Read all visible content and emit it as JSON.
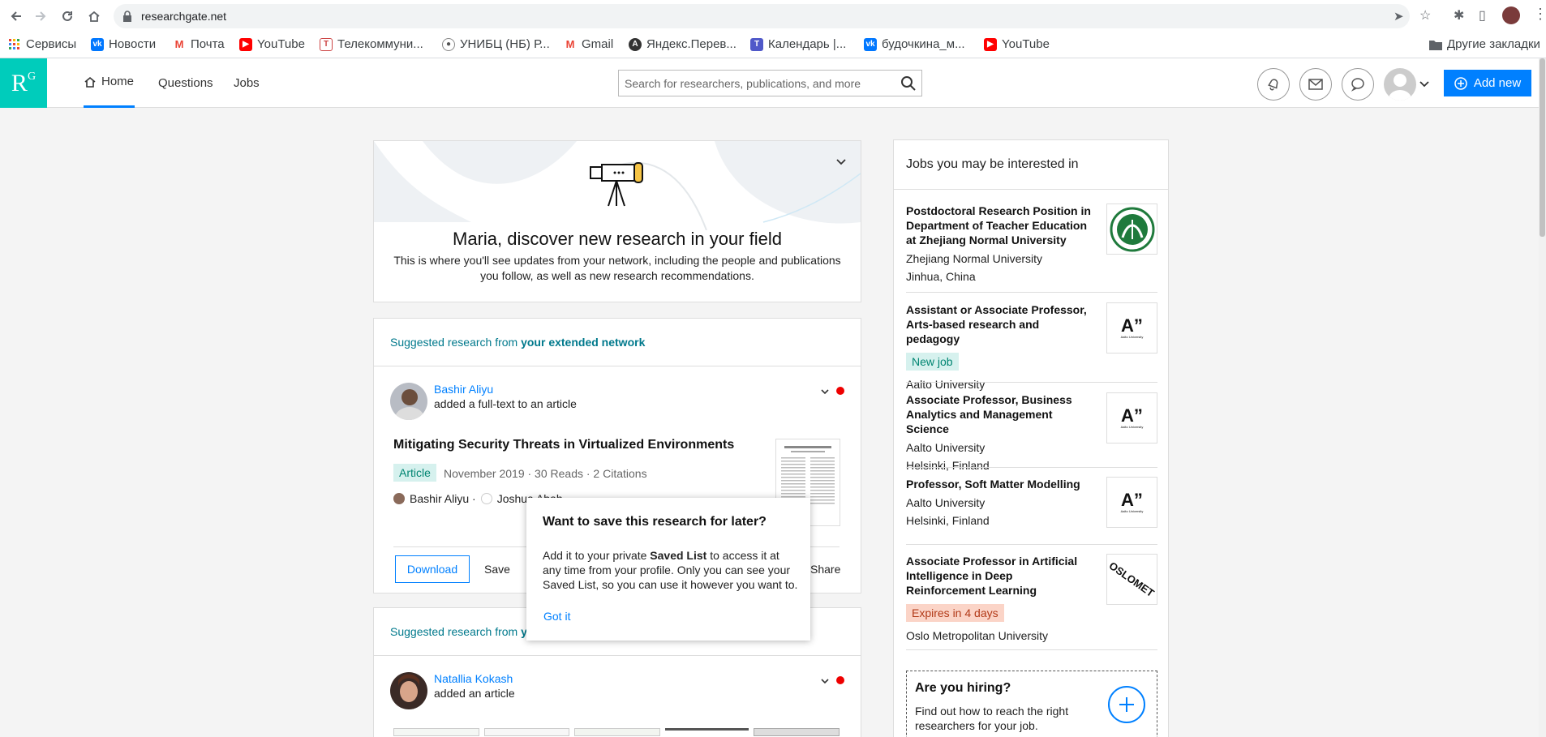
{
  "browser": {
    "url": "researchgate.net",
    "bookmarks": [
      {
        "label": "Сервисы",
        "icon": "apps-grid-icon"
      },
      {
        "label": "Новости",
        "icon": "vk-icon"
      },
      {
        "label": "Почта",
        "icon": "gmail-icon"
      },
      {
        "label": "YouTube",
        "icon": "youtube-icon"
      },
      {
        "label": "Телекоммуни...",
        "icon": "site-icon"
      },
      {
        "label": "УНИБЦ (НБ) Р...",
        "icon": "site-icon"
      },
      {
        "label": "Gmail",
        "icon": "gmail-icon"
      },
      {
        "label": "Яндекс.Перев...",
        "icon": "yandex-translate-icon"
      },
      {
        "label": "Календарь |...",
        "icon": "teams-icon"
      },
      {
        "label": "будочкина_м...",
        "icon": "vk-icon"
      },
      {
        "label": "YouTube",
        "icon": "youtube-icon"
      }
    ],
    "other_bookmarks": "Другие закладки"
  },
  "header": {
    "logo": "R",
    "logo_sup": "G",
    "tabs": [
      {
        "label": "Home"
      },
      {
        "label": "Questions"
      },
      {
        "label": "Jobs"
      }
    ],
    "search_placeholder": "Search for researchers, publications, and more",
    "add_new": "Add new"
  },
  "hero": {
    "title": "Maria, discover new research in your field",
    "text": "This is where you'll see updates from your network, including the people and publications you follow, as well as new research recommendations."
  },
  "feed": [
    {
      "heading_prefix": "Suggested research from ",
      "heading_strong": "your extended network",
      "person": "Bashir Aliyu",
      "action": "added a full-text to an article",
      "pub_title": "Mitigating Security Threats in Virtualized Environments",
      "badge": "Article",
      "meta": "November 2019 · 30 Reads · 2 Citations",
      "author1": "Bashir Aliyu ·",
      "author2": "Joshua Abah",
      "download": "Download",
      "save": "Save",
      "share": "Share"
    },
    {
      "heading_prefix": "Suggested research from ",
      "heading_strong": "yo",
      "person": "Natallia Kokash",
      "action": "added an article"
    }
  ],
  "popup": {
    "title": "Want to save this research for later?",
    "body_1": "Add it to your private ",
    "body_strong": "Saved List",
    "body_2": " to access it at any time from your profile. Only you can see your Saved List, so you can use it however you want to.",
    "got_it": "Got it"
  },
  "jobs": {
    "title": "Jobs you may be interested in",
    "items": [
      {
        "title": "Postdoctoral Research Position in Department of Teacher Education at Zhejiang Normal University",
        "org": "Zhejiang Normal University",
        "location": "Jinhua, China",
        "badge": "",
        "logo": "zjnu-seal"
      },
      {
        "title": "Assistant or Associate Professor, Arts-based research and pedagogy",
        "badge": "New job",
        "org": "Aalto University",
        "location": "",
        "logo": "aalto"
      },
      {
        "title": "Associate Professor, Business Analytics and Management Science",
        "org": "Aalto University",
        "location": "Helsinki, Finland",
        "badge": "",
        "logo": "aalto"
      },
      {
        "title": "Professor, Soft Matter Modelling",
        "org": "Aalto University",
        "location": "Helsinki, Finland",
        "badge": "",
        "logo": "aalto"
      },
      {
        "title": "Associate Professor in Artificial Intelligence in Deep Reinforcement Learning",
        "badge": "Expires in 4 days",
        "org": "Oslo Metropolitan University",
        "location": "",
        "logo": "oslomet"
      }
    ],
    "logo_text": {
      "aalto": "A”",
      "aalto_sub": "Aalto University",
      "oslomet": "OSLOMET"
    },
    "hiring_title": "Are you hiring?",
    "hiring_text": "Find out how to reach the right researchers for your job."
  }
}
